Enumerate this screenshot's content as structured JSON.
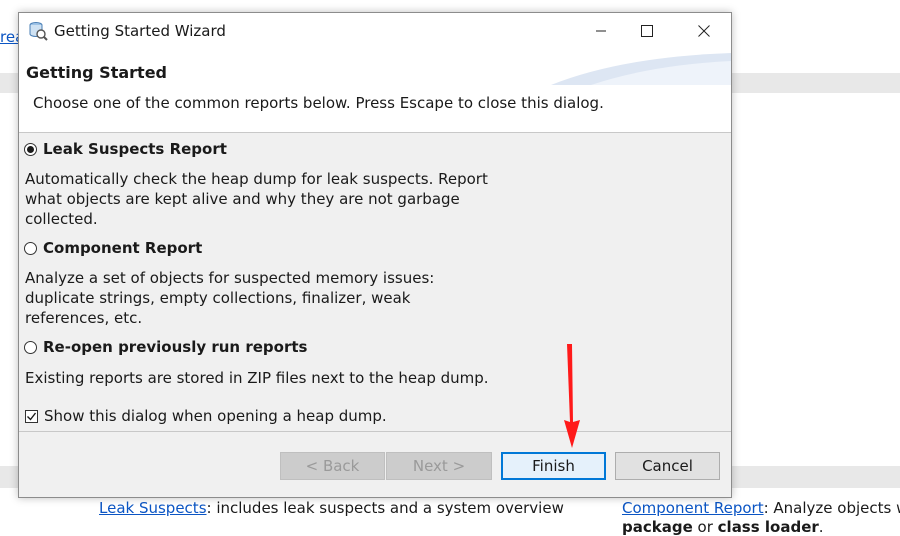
{
  "background": {
    "top_link_fragment": "rea",
    "link_leak_suspects": "Leak Suspects",
    "leak_suspects_desc": ": includes leak suspects and a system overview",
    "link_component_report": "Component Report",
    "component_report_desc": ": Analyze objects w",
    "bottom_line": {
      "part1": "package",
      "part2": " or ",
      "part3": "class loader",
      "part4": "."
    }
  },
  "dialog": {
    "title": "Getting Started Wizard",
    "window_controls": {
      "minimize": "—",
      "maximize": "☐",
      "close": "✕"
    },
    "header": {
      "title": "Getting Started",
      "description": "Choose one of the common reports below. Press Escape to close this dialog."
    },
    "options": [
      {
        "label": "Leak Suspects Report",
        "checked": true,
        "description": "Automatically check the heap dump for leak suspects. Report what objects are kept alive and why they are not garbage collected."
      },
      {
        "label": "Component Report",
        "checked": false,
        "description": "Analyze a set of objects for suspected memory issues: duplicate strings, empty collections, finalizer, weak references, etc."
      },
      {
        "label": "Re-open previously run reports",
        "checked": false,
        "description": "Existing reports are stored in ZIP files next to the heap dump."
      }
    ],
    "show_dialog_checkbox": {
      "label": "Show this dialog when opening a heap dump.",
      "checked": true
    },
    "buttons": {
      "back": "< Back",
      "next": "Next >",
      "finish": "Finish",
      "cancel": "Cancel"
    }
  },
  "colors": {
    "accent": "#0078d7",
    "link": "#0b55c4",
    "annotation_arrow": "#ff1a1a"
  }
}
